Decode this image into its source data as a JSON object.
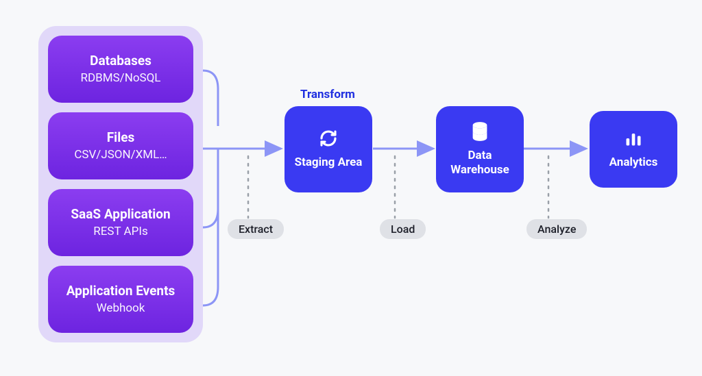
{
  "sources": [
    {
      "title": "Databases",
      "subtitle": "RDBMS/NoSQL"
    },
    {
      "title": "Files",
      "subtitle": "CSV/JSON/XML…"
    },
    {
      "title": "SaaS Application",
      "subtitle": "REST APIs"
    },
    {
      "title": "Application Events",
      "subtitle": "Webhook"
    }
  ],
  "stages": {
    "staging": {
      "label": "Staging Area",
      "caption": "Transform"
    },
    "warehouse": {
      "label": "Data Warehouse"
    },
    "analytics": {
      "label": "Analytics"
    }
  },
  "steps": {
    "extract": "Extract",
    "load": "Load",
    "analyze": "Analyze"
  }
}
